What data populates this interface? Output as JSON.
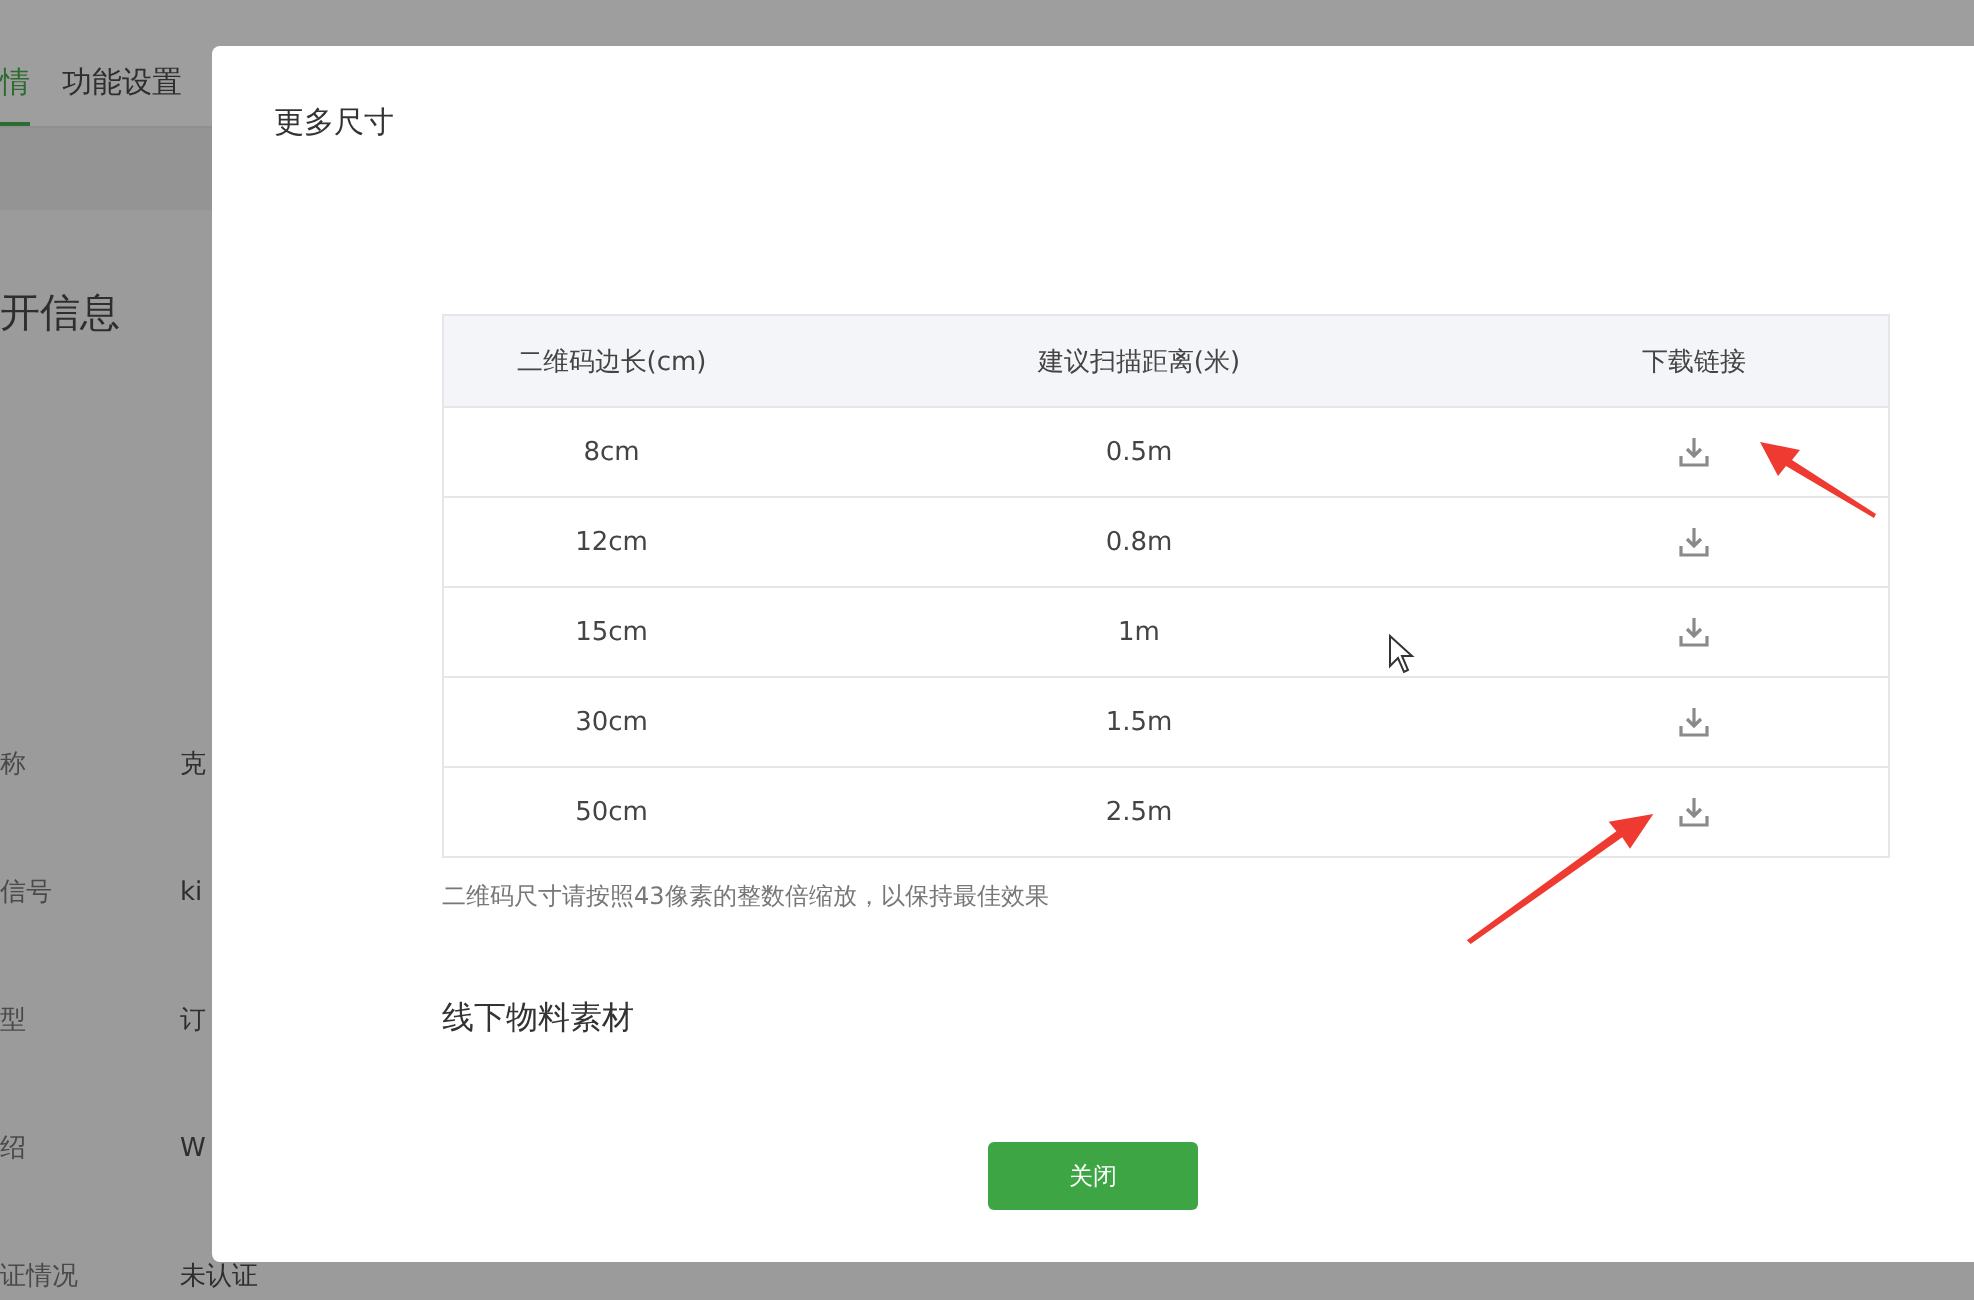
{
  "background_page": {
    "tabs": [
      {
        "label": "情",
        "selected": true
      },
      {
        "label": "功能设置",
        "selected": false
      }
    ],
    "heading": "开信息",
    "fields": [
      {
        "label": "称",
        "value": "克"
      },
      {
        "label": "信号",
        "value": "ki"
      },
      {
        "label": "型",
        "value": "订"
      },
      {
        "label": "绍",
        "value": "W"
      },
      {
        "label": "证情况",
        "value": "未认证"
      }
    ]
  },
  "dialog": {
    "title": "更多尺寸",
    "table": {
      "columns": [
        "二维码边长(cm)",
        "建议扫描距离(米)",
        "下载链接"
      ],
      "rows": [
        [
          "8cm",
          "0.5m"
        ],
        [
          "12cm",
          "0.8m"
        ],
        [
          "15cm",
          "1m"
        ],
        [
          "30cm",
          "1.5m"
        ],
        [
          "50cm",
          "2.5m"
        ]
      ]
    },
    "note": "二维码尺寸请按照43像素的整数倍缩放，以保持最佳效果",
    "section_heading": "线下物料素材",
    "button": "关闭"
  }
}
